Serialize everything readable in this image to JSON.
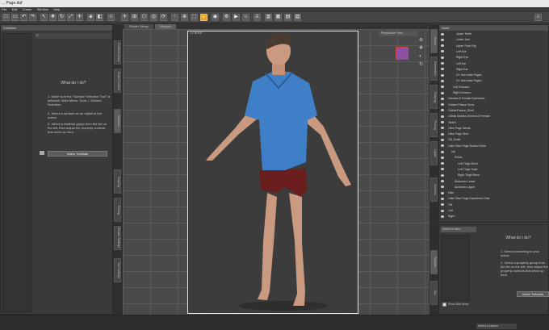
{
  "window": {
    "title": "... Page.duf"
  },
  "menu": [
    "File",
    "Edit",
    "Create",
    "Window",
    "Help"
  ],
  "left_tab": "Surfaces",
  "viewport_tabs": [
    "Render Library",
    "Viewport"
  ],
  "viewport": {
    "resolution": "1:1 fit 900",
    "camera": "Perspective View"
  },
  "help_left": {
    "title": "What do I do?",
    "steps": [
      "1. Make sure the \"Surface Selection Tool\" is selected. Main Menu: Tools > Surface Selection",
      "2. Select a surface on an object in the scene.",
      "3. Select a material group from the list on the left, then adjust the property controls that show up here."
    ],
    "button": "Video Tutorials"
  },
  "scene": {
    "header": "Node",
    "nodes": [
      "Upper Teeth",
      "Lower Jaw",
      "Upper Face Rig",
      "Left Eye",
      "Right Eye",
      "Left Ear",
      "Right Ear",
      "G1 Hair Male Pages",
      "G1 Hair Male Pages",
      "Left Forearm",
      "Right Forearm",
      "Genesis 8 Female Eyelashes",
      "Golden Palace Gens",
      "GoldenPalace_Shell",
      "v.Bella Maiden Genesis 8 Female",
      "Tshirt1",
      "Olive Page Wrists",
      "Olive Page Shirt",
      "G8_Scale",
      "Little Olive Page Bottom Robe",
      "hip",
      "Pelvis",
      "Left Thigh Bend",
      "Left Thigh Twist",
      "Right Thigh Bend",
      "Abdomen Lower",
      "Abdomen Upper",
      "Hide",
      "Little Olive Page Experiment Hair",
      "Tiki",
      "Left",
      "Right"
    ]
  },
  "help_right": {
    "dropdown": "Select an Item",
    "title": "What do I do?",
    "steps": [
      "1. Select something in your scene.",
      "2. Select a property group from the list on the left, then adjust the property controls that show up here."
    ],
    "checkbox": "Show Sub Items",
    "button": "Video Tutorials"
  },
  "right_tabs": [
    "Scene",
    "Parameters",
    "Shaping",
    "Posing",
    "Lights",
    "Surfaces",
    "Timeline",
    "Aux"
  ],
  "left_vtabs": [
    "Content Library",
    "Smart Content",
    "Surfaces",
    "Shaping",
    "Posing",
    "Render Settings",
    "Tool Settings"
  ],
  "statusbar": {
    "layout": "Select a Lesson"
  },
  "colors": {
    "highlight_tool": "#e0a040",
    "viewport_frame": "#e6e6e6"
  }
}
